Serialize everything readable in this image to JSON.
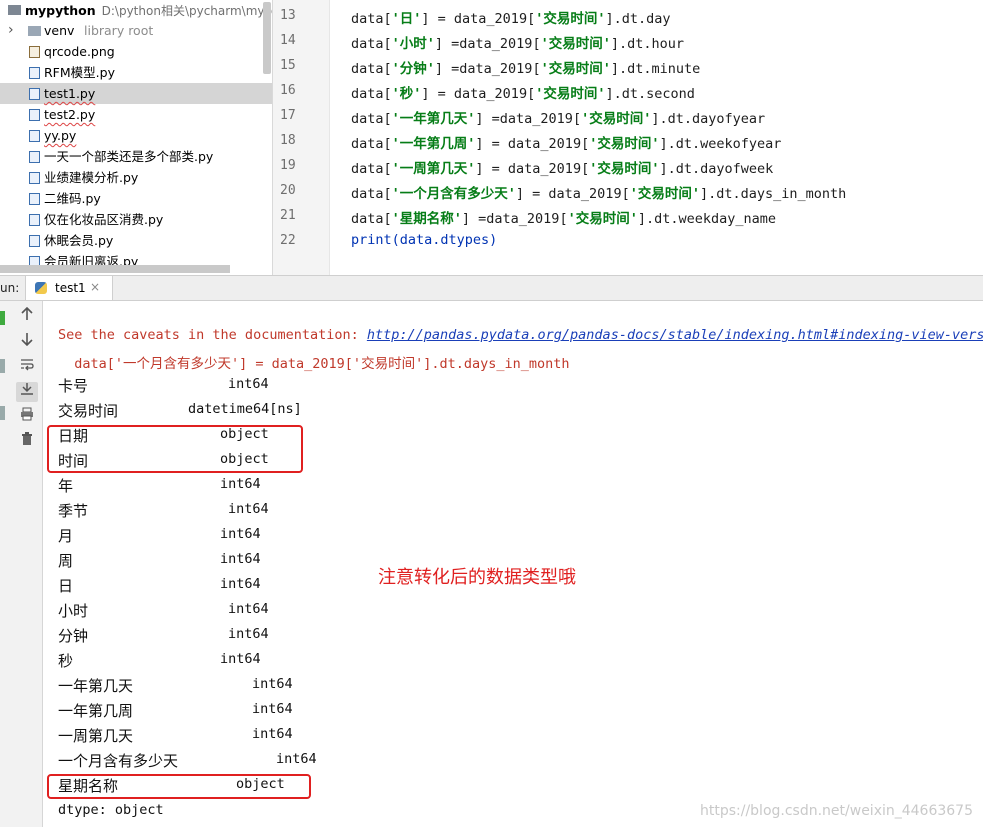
{
  "project": {
    "root_name": "mypython",
    "root_path": "D:\\python相关\\pycharm\\mypyth",
    "items": [
      {
        "name": "venv",
        "hint": "library root",
        "type": "folder"
      },
      {
        "name": "qrcode.png",
        "type": "png"
      },
      {
        "name": "RFM模型.py",
        "type": "py"
      },
      {
        "name": "test1.py",
        "type": "py",
        "selected": true
      },
      {
        "name": "test2.py",
        "type": "py"
      },
      {
        "name": "yy.py",
        "type": "py"
      },
      {
        "name": "一天一个部类还是多个部类.py",
        "type": "py"
      },
      {
        "name": "业绩建模分析.py",
        "type": "py"
      },
      {
        "name": "二维码.py",
        "type": "py"
      },
      {
        "name": "仅在化妆品区消费.py",
        "type": "py"
      },
      {
        "name": "休眠会员.py",
        "type": "py"
      },
      {
        "name": "会员新旧离返.py",
        "type": "py"
      }
    ]
  },
  "editor": {
    "lines": [
      {
        "no": "13",
        "a": "data[",
        "s": "'日'",
        "b": "] = data_2019[",
        "s2": "'交易时间'",
        "c": "].dt.day"
      },
      {
        "no": "14",
        "a": "data[",
        "s": "'小时'",
        "b": "] =data_2019[",
        "s2": "'交易时间'",
        "c": "].dt.hour"
      },
      {
        "no": "15",
        "a": "data[",
        "s": "'分钟'",
        "b": "] =data_2019[",
        "s2": "'交易时间'",
        "c": "].dt.minute"
      },
      {
        "no": "16",
        "a": "data[",
        "s": "'秒'",
        "b": "] = data_2019[",
        "s2": "'交易时间'",
        "c": "].dt.second"
      },
      {
        "no": "17",
        "a": "data[",
        "s": "'一年第几天'",
        "b": "] =data_2019[",
        "s2": "'交易时间'",
        "c": "].dt.dayofyear"
      },
      {
        "no": "18",
        "a": "data[",
        "s": "'一年第几周'",
        "b": "] = data_2019[",
        "s2": "'交易时间'",
        "c": "].dt.weekofyear"
      },
      {
        "no": "19",
        "a": "data[",
        "s": "'一周第几天'",
        "b": "] = data_2019[",
        "s2": "'交易时间'",
        "c": "].dt.dayofweek"
      },
      {
        "no": "20",
        "a": "data[",
        "s": "'一个月含有多少天'",
        "b": "] = data_2019[",
        "s2": "'交易时间'",
        "c": "].dt.days_in_month"
      },
      {
        "no": "21",
        "a": "data[",
        "s": "'星期名称'",
        "b": "] =data_2019[",
        "s2": "'交易时间'",
        "c": "].dt.weekday_name"
      },
      {
        "no": "22",
        "a": "",
        "s": "",
        "b": "",
        "s2": "",
        "c": "print(data.dtypes)"
      }
    ]
  },
  "run": {
    "label": "un:",
    "tab_label": "test1",
    "close_glyph": "×"
  },
  "console": {
    "warning_prefix": "See the caveats in the documentation: ",
    "warning_link": "http://pandas.pydata.org/pandas-docs/stable/indexing.html#indexing-view-versus-copy",
    "warning_code": "  data['一个月含有多少天'] = data_2019['交易时间'].dt.days_in_month",
    "dtypes": [
      {
        "name": "卡号",
        "type": "int64"
      },
      {
        "name": "交易时间",
        "type": "datetime64[ns]"
      },
      {
        "name": "日期",
        "type": "object"
      },
      {
        "name": "时间",
        "type": "object"
      },
      {
        "name": "年",
        "type": "int64"
      },
      {
        "name": "季节",
        "type": "int64"
      },
      {
        "name": "月",
        "type": "int64"
      },
      {
        "name": "周",
        "type": "int64"
      },
      {
        "name": "日",
        "type": "int64"
      },
      {
        "name": "小时",
        "type": "int64"
      },
      {
        "name": "分钟",
        "type": "int64"
      },
      {
        "name": "秒",
        "type": "int64"
      },
      {
        "name": "一年第几天",
        "type": "int64"
      },
      {
        "name": "一年第几周",
        "type": "int64"
      },
      {
        "name": "一周第几天",
        "type": "int64"
      },
      {
        "name": "一个月含有多少天",
        "type": "int64"
      },
      {
        "name": "星期名称",
        "type": "object"
      }
    ],
    "footer": "dtype: object"
  },
  "annotation": "注意转化后的数据类型哦",
  "watermark": "https://blog.csdn.net/weixin_44663675",
  "colors": {
    "annotation": "#e02020",
    "string_literal": "#067d17",
    "warning": "#c0392b",
    "link": "#1a3fb8"
  }
}
